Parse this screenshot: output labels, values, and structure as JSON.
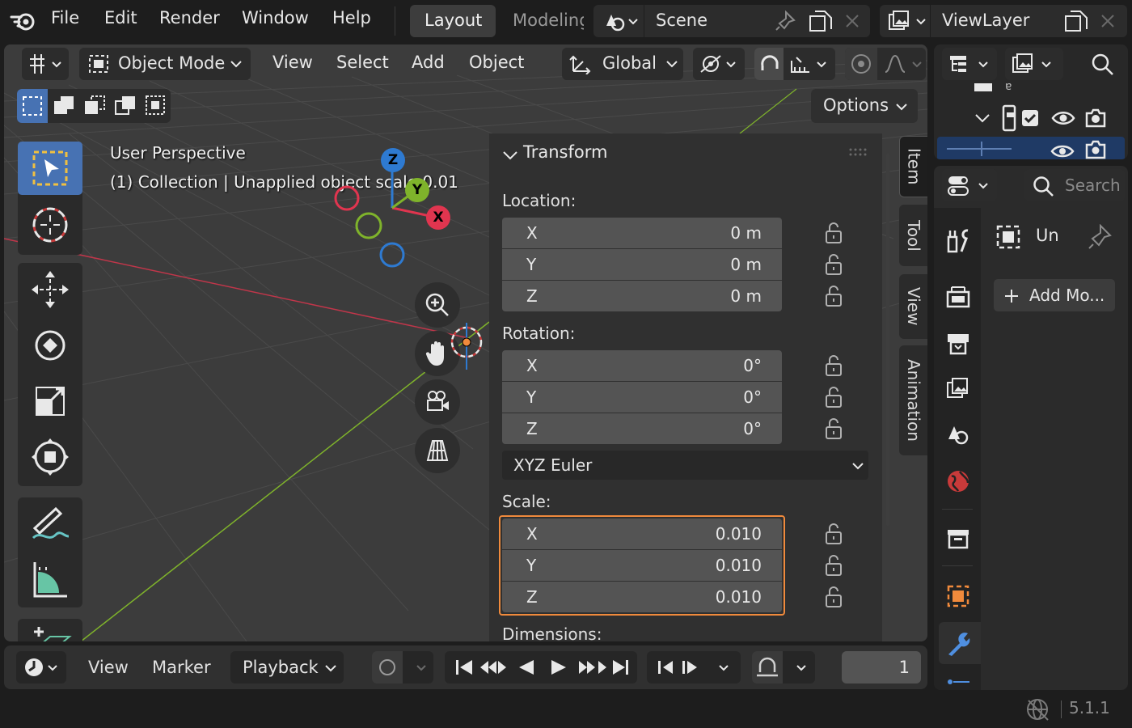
{
  "topbar": {
    "menus": [
      "File",
      "Edit",
      "Render",
      "Window",
      "Help"
    ],
    "workspaces": [
      "Layout",
      "Modeling"
    ],
    "scene": "Scene",
    "view_layer": "ViewLayer"
  },
  "viewport": {
    "mode": "Object Mode",
    "menus": [
      "View",
      "Select",
      "Add",
      "Object"
    ],
    "orientation": "Global",
    "options_label": "Options",
    "overlay_title": "User Perspective",
    "overlay_info": "(1) Collection | Unapplied object scale 0.01"
  },
  "npanel": {
    "section_title": "Transform",
    "location_label": "Location:",
    "location": [
      {
        "axis": "X",
        "value": "0 m"
      },
      {
        "axis": "Y",
        "value": "0 m"
      },
      {
        "axis": "Z",
        "value": "0 m"
      }
    ],
    "rotation_label": "Rotation:",
    "rotation": [
      {
        "axis": "X",
        "value": "0°"
      },
      {
        "axis": "Y",
        "value": "0°"
      },
      {
        "axis": "Z",
        "value": "0°"
      }
    ],
    "rotation_mode": "XYZ Euler",
    "scale_label": "Scale:",
    "scale": [
      {
        "axis": "X",
        "value": "0.010"
      },
      {
        "axis": "Y",
        "value": "0.010"
      },
      {
        "axis": "Z",
        "value": "0.010"
      }
    ],
    "dimensions_label": "Dimensions:",
    "tabs": [
      "Item",
      "Tool",
      "View",
      "Animation"
    ]
  },
  "gizmo": {
    "z": "Z",
    "y": "Y",
    "x": "X"
  },
  "properties": {
    "search_placeholder": "Search",
    "object_name": "Un",
    "add_modifier": "Add Mo..."
  },
  "timeline": {
    "menus": [
      "View",
      "Marker"
    ],
    "playback": "Playback",
    "current_frame": "1"
  },
  "statusbar": {
    "version": "5.1.1"
  },
  "colors": {
    "accent": "#4772b3",
    "highlight": "#f08a3c",
    "axis_x": "#e0354f",
    "axis_y": "#7fb32b",
    "axis_z": "#2e7ad1"
  }
}
